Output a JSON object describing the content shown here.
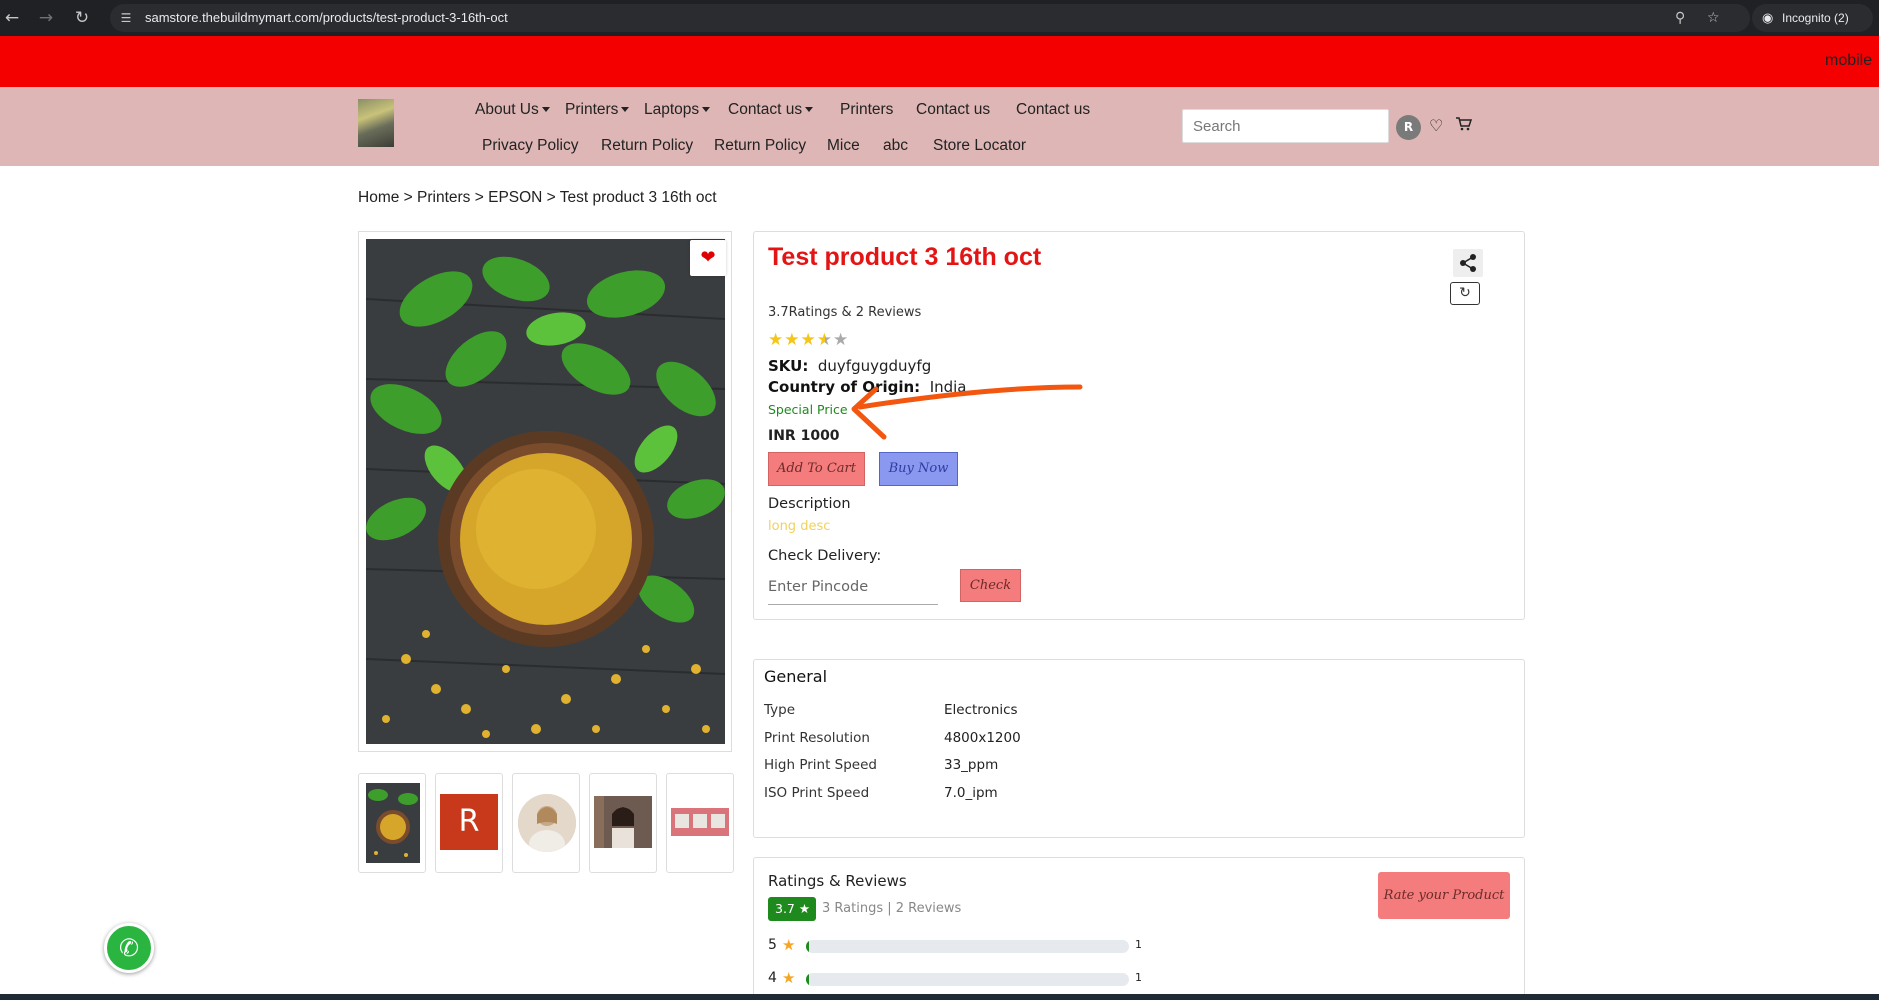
{
  "browser": {
    "url": "samstore.thebuildmymart.com/products/test-product-3-16th-oct",
    "profile": "Incognito (2)"
  },
  "marquee": {
    "text": "mobile"
  },
  "header": {
    "nav_row1": [
      {
        "label": "About Us",
        "dropdown": true
      },
      {
        "label": "Printers",
        "dropdown": true
      },
      {
        "label": "Laptops",
        "dropdown": true
      },
      {
        "label": "Contact us",
        "dropdown": true
      },
      {
        "label": "Printers",
        "dropdown": false
      },
      {
        "label": "Contact us",
        "dropdown": false
      },
      {
        "label": "Contact us",
        "dropdown": false
      }
    ],
    "nav_row2": [
      {
        "label": "Privacy Policy"
      },
      {
        "label": "Return Policy"
      },
      {
        "label": "Return Policy"
      },
      {
        "label": "Mice"
      },
      {
        "label": "abc"
      },
      {
        "label": "Store Locator"
      }
    ],
    "search_placeholder": "Search",
    "avatar_initial": "R"
  },
  "breadcrumb": [
    "Home",
    "Printers",
    "EPSON",
    "Test product 3 16th oct"
  ],
  "product": {
    "title": "Test product 3 16th oct",
    "ratings_summary": "3.7Ratings & 2 Reviews",
    "rating": 3.7,
    "sku_label": "SKU:",
    "sku": "duyfguygduyfg",
    "origin_label": "Country of Origin:",
    "origin": "India",
    "special_price_label": "Special Price",
    "price": "INR 1000",
    "add_to_cart": "Add To Cart",
    "buy_now": "Buy Now",
    "description_heading": "Description",
    "description": "long desc",
    "check_delivery_heading": "Check Delivery:",
    "pincode_placeholder": "Enter Pincode",
    "check_button": "Check",
    "thumbnail_letter": "R"
  },
  "general": {
    "heading": "General",
    "specs": [
      {
        "key": "Type",
        "value": "Electronics"
      },
      {
        "key": "Print Resolution",
        "value": "4800x1200"
      },
      {
        "key": "High Print Speed",
        "value": "33_ppm"
      },
      {
        "key": "ISO Print Speed",
        "value": "7.0_ipm"
      }
    ]
  },
  "reviews": {
    "heading": "Ratings & Reviews",
    "badge": "3.7",
    "count_text": "3 Ratings | 2 Reviews",
    "rate_button": "Rate your Product",
    "bars": [
      {
        "star": "5",
        "count": "1",
        "fraction": 0.01
      },
      {
        "star": "4",
        "count": "1",
        "fraction": 0.01
      }
    ]
  },
  "colors": {
    "marquee_bg": "#f40000",
    "header_bg": "#dfb6b6",
    "title": "#e41414",
    "special_price": "#1e8a1e",
    "annotation_arrow": "#f2560f"
  }
}
